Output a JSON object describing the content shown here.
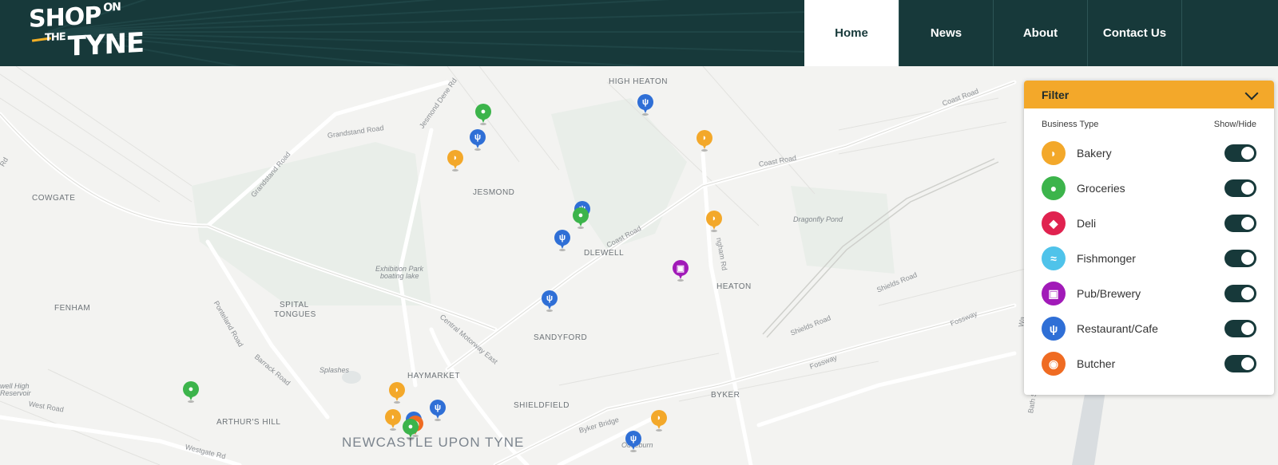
{
  "brand": {
    "line1": "SHOP",
    "on": "ON",
    "the": "THE",
    "line2": "TYNE"
  },
  "nav": [
    {
      "label": "Home",
      "active": true
    },
    {
      "label": "News",
      "active": false
    },
    {
      "label": "About",
      "active": false
    },
    {
      "label": "Contact Us",
      "active": false
    }
  ],
  "map": {
    "places": {
      "high_heaton": "HIGH HEATON",
      "jesmond": "JESMOND",
      "cowgate": "COWGATE",
      "fenham": "FENHAM",
      "spital_tongues_1": "SPITAL",
      "spital_tongues_2": "TONGUES",
      "heaton": "HEATON",
      "sandyford": "SANDYFORD",
      "haymarket": "HAYMARKET",
      "shieldfield": "SHIELDFIELD",
      "byker": "BYKER",
      "arthurs_hill": "ARTHUR'S HILL",
      "newcastle": "NEWCASTLE UPON TYNE",
      "ouseburn": "Ouseburn",
      "dragonfly_pond": "Dragonfly Pond",
      "exhibition_park_1": "Exhibition Park",
      "exhibition_park_2": "boating lake",
      "splashes": "Splashes",
      "fenham_high_1": "well High",
      "fenham_high_2": "Reservoir",
      "jesmond_dene_partial": "DLEWELL"
    },
    "roads": {
      "jesmond_dene_rd": "Jesmond Dene Rd",
      "grandstand_rd_1": "Grandstand Road",
      "grandstand_rd_2": "Grandstand Road",
      "coast_rd_1": "Coast Road",
      "coast_rd_2": "Coast Road",
      "coast_rd_3": "Coast Road",
      "ponteland_rd": "Ponteland Road",
      "barrack_rd": "Barrack Road",
      "central_motorway": "Central Motorway East",
      "shields_rd_1": "Shields Road",
      "shields_rd_2": "Shields Road",
      "fossway_1": "Fossway",
      "fossway_2": "Fossway",
      "byker_bridge": "Byker Bridge",
      "west_road": "West Road",
      "westgate_rd": "Westgate Rd",
      "bath_street": "Bath Street",
      "wardley": "Wa",
      "rd_left": "Rd",
      "ngham_rd": "ngham Rd"
    }
  },
  "filter": {
    "title": "Filter",
    "col_type": "Business Type",
    "col_toggle": "Show/Hide",
    "items": [
      {
        "label": "Bakery",
        "color": "#f3a82a",
        "icon": "bread-icon",
        "glyph": "◗",
        "on": true
      },
      {
        "label": "Groceries",
        "color": "#3cb44b",
        "icon": "apple-icon",
        "glyph": "●",
        "on": true
      },
      {
        "label": "Deli",
        "color": "#e0224f",
        "icon": "cheese-icon",
        "glyph": "◆",
        "on": true
      },
      {
        "label": "Fishmonger",
        "color": "#4fc3ea",
        "icon": "shrimp-icon",
        "glyph": "≈",
        "on": true
      },
      {
        "label": "Pub/Brewery",
        "color": "#a11ab8",
        "icon": "beer-mug-icon",
        "glyph": "▣",
        "on": true
      },
      {
        "label": "Restaurant/Cafe",
        "color": "#2f6fd6",
        "icon": "cutlery-icon",
        "glyph": "ψ",
        "on": true
      },
      {
        "label": "Butcher",
        "color": "#ef6b22",
        "icon": "steak-icon",
        "glyph": "◉",
        "on": true
      }
    ]
  }
}
